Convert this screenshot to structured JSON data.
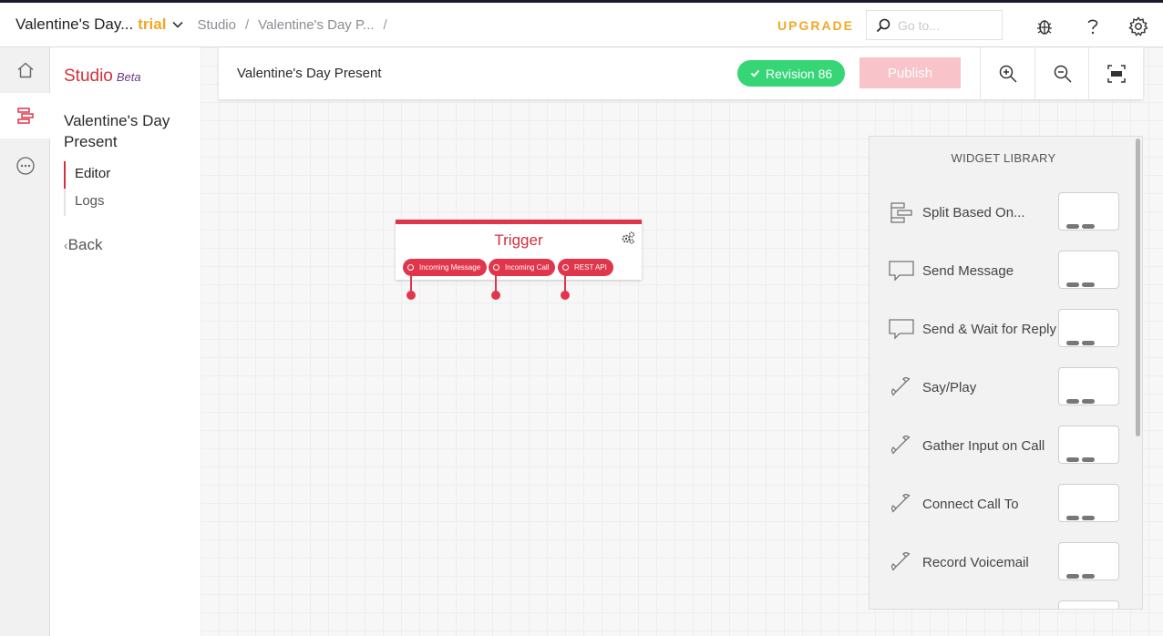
{
  "header": {
    "account_name": "Valentine's Day...",
    "account_badge": "trial",
    "breadcrumbs": [
      "Studio",
      "Valentine's Day P..."
    ],
    "breadcrumb_separator": "/",
    "upgrade_label": "UPGRADE",
    "search_placeholder": "Go to..."
  },
  "sidebar": {
    "product_name": "Studio",
    "product_badge": "Beta",
    "flow_name": "Valentine's Day Present",
    "nav": [
      "Editor",
      "Logs"
    ],
    "active_nav": "Editor",
    "back_label": "Back",
    "back_chevron": "‹"
  },
  "toolbar": {
    "flow_name": "Valentine's Day Present",
    "revision_label": "Revision 86",
    "publish_label": "Publish"
  },
  "trigger": {
    "title": "Trigger",
    "transitions": [
      "Incoming Message",
      "Incoming Call",
      "REST API"
    ]
  },
  "library": {
    "title": "WIDGET LIBRARY",
    "items": [
      {
        "label": "Split Based On...",
        "icon": "split-icon"
      },
      {
        "label": "Send Message",
        "icon": "message-icon"
      },
      {
        "label": "Send & Wait for Reply",
        "icon": "message-reply-icon"
      },
      {
        "label": "Say/Play",
        "icon": "phone-icon"
      },
      {
        "label": "Gather Input on Call",
        "icon": "phone-icon"
      },
      {
        "label": "Connect Call To",
        "icon": "phone-icon"
      },
      {
        "label": "Record Voicemail",
        "icon": "phone-icon"
      }
    ]
  },
  "colors": {
    "brand_red": "#e0354a",
    "upgrade_orange": "#f2a823",
    "revision_green": "#36d576",
    "publish_disabled": "#f8c3c9"
  }
}
